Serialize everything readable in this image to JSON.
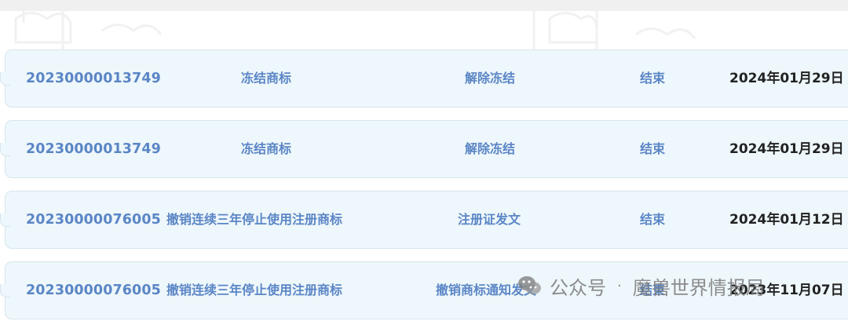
{
  "records": [
    {
      "id": "20230000013749",
      "type": "冻结商标",
      "step": "解除冻结",
      "status": "结束",
      "date": "2024年01月29日"
    },
    {
      "id": "20230000013749",
      "type": "冻结商标",
      "step": "解除冻结",
      "status": "结束",
      "date": "2024年01月29日"
    },
    {
      "id": "20230000076005",
      "type": "撤销连续三年停止使用注册商标",
      "step": "注册证发文",
      "status": "结束",
      "date": "2024年01月12日"
    },
    {
      "id": "20230000076005",
      "type": "撤销连续三年停止使用注册商标",
      "step": "撤销商标通知发文",
      "status": "结束",
      "date": "2023年11月07日"
    }
  ],
  "watermark": {
    "icon": "wechat-icon",
    "source": "公众号",
    "separator": "·",
    "account": "魔兽世界情报局"
  },
  "colors": {
    "link_text": "#5b86c6",
    "date_text": "#222222",
    "row_bg": "#eef7fb",
    "row_border": "#d7e6ee",
    "top_bar": "#f0f0f0"
  }
}
